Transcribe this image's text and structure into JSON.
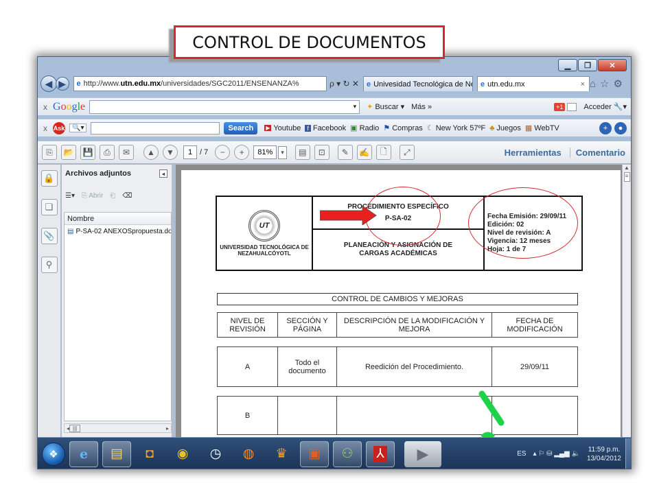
{
  "slide": {
    "title": "CONTROL DE DOCUMENTOS"
  },
  "browser": {
    "address": "http://www.utn.edu.mx/universidades/SGC2011/ENSENANZA%",
    "address_domain": "utn.edu.mx",
    "address_prefix": "http://www.",
    "address_suffix": "/universidades/SGC2011/ENSENANZA%",
    "address_controls": "ρ ▾ ↻ ✕",
    "tabs": [
      {
        "label": "Univesidad Tecnológica de Ne..."
      },
      {
        "label": "utn.edu.mx",
        "close": "×"
      }
    ]
  },
  "google_toolbar": {
    "logo": [
      "G",
      "o",
      "o",
      "g",
      "l",
      "e"
    ],
    "buscar": "Buscar",
    "mas": "Más »",
    "acceder": "Acceder",
    "close": "x",
    "badge": "+1"
  },
  "ask_toolbar": {
    "close": "x",
    "logo": "Ask",
    "search_btn": "Search",
    "items": [
      "Youtube",
      "Facebook",
      "Radio",
      "Compras",
      "New York 57ºF",
      "Juegos",
      "WebTV"
    ]
  },
  "pdf": {
    "page_current": "1",
    "page_total": "/ 7",
    "zoom": "81%",
    "herramientas": "Herramientas",
    "comentario": "Comentario"
  },
  "attachments": {
    "title": "Archivos adjuntos",
    "abrir": "Abrir",
    "column": "Nombre",
    "file": "P-SA-02 ANEXOSpropuesta.do"
  },
  "document": {
    "institution": "UNIVERSIDAD TECNOLÓGICA DE NEZAHUALCÓYOTL",
    "seal_text": "UT",
    "proc_title": "PROCEDIMIENTO ESPECÍFICO",
    "proc_code": "P-SA-02",
    "proc_name": "PLANEACIÓN Y ASIGNACIÓN DE CARGAS ACADÉMICAS",
    "fecha": "Fecha Emisión: 29/09/11",
    "edicion": "Edición: 02",
    "nivel": "Nivel de revisión: A",
    "vigencia": "Vigencia: 12 meses",
    "hoja": "Hoja: 1 de 7",
    "changes_title": "CONTROL DE CAMBIOS Y MEJORAS",
    "columns": [
      "NIVEL DE REVISIÓN",
      "SECCIÓN Y PÁGINA",
      "DESCRIPCIÓN DE LA MODIFICACIÓN Y MEJORA",
      "FECHA DE MODIFICACIÓN"
    ],
    "rows": [
      [
        "A",
        "Todo el documento",
        "Reedición del Procedimiento.",
        "29/09/11"
      ],
      [
        "B",
        "",
        "",
        ""
      ]
    ]
  },
  "taskbar": {
    "lang": "ES",
    "time": "11:59 p.m.",
    "date": "13/04/2012"
  },
  "colors": {
    "accent_red": "#d4272e",
    "link_blue": "#3d6a9d"
  }
}
